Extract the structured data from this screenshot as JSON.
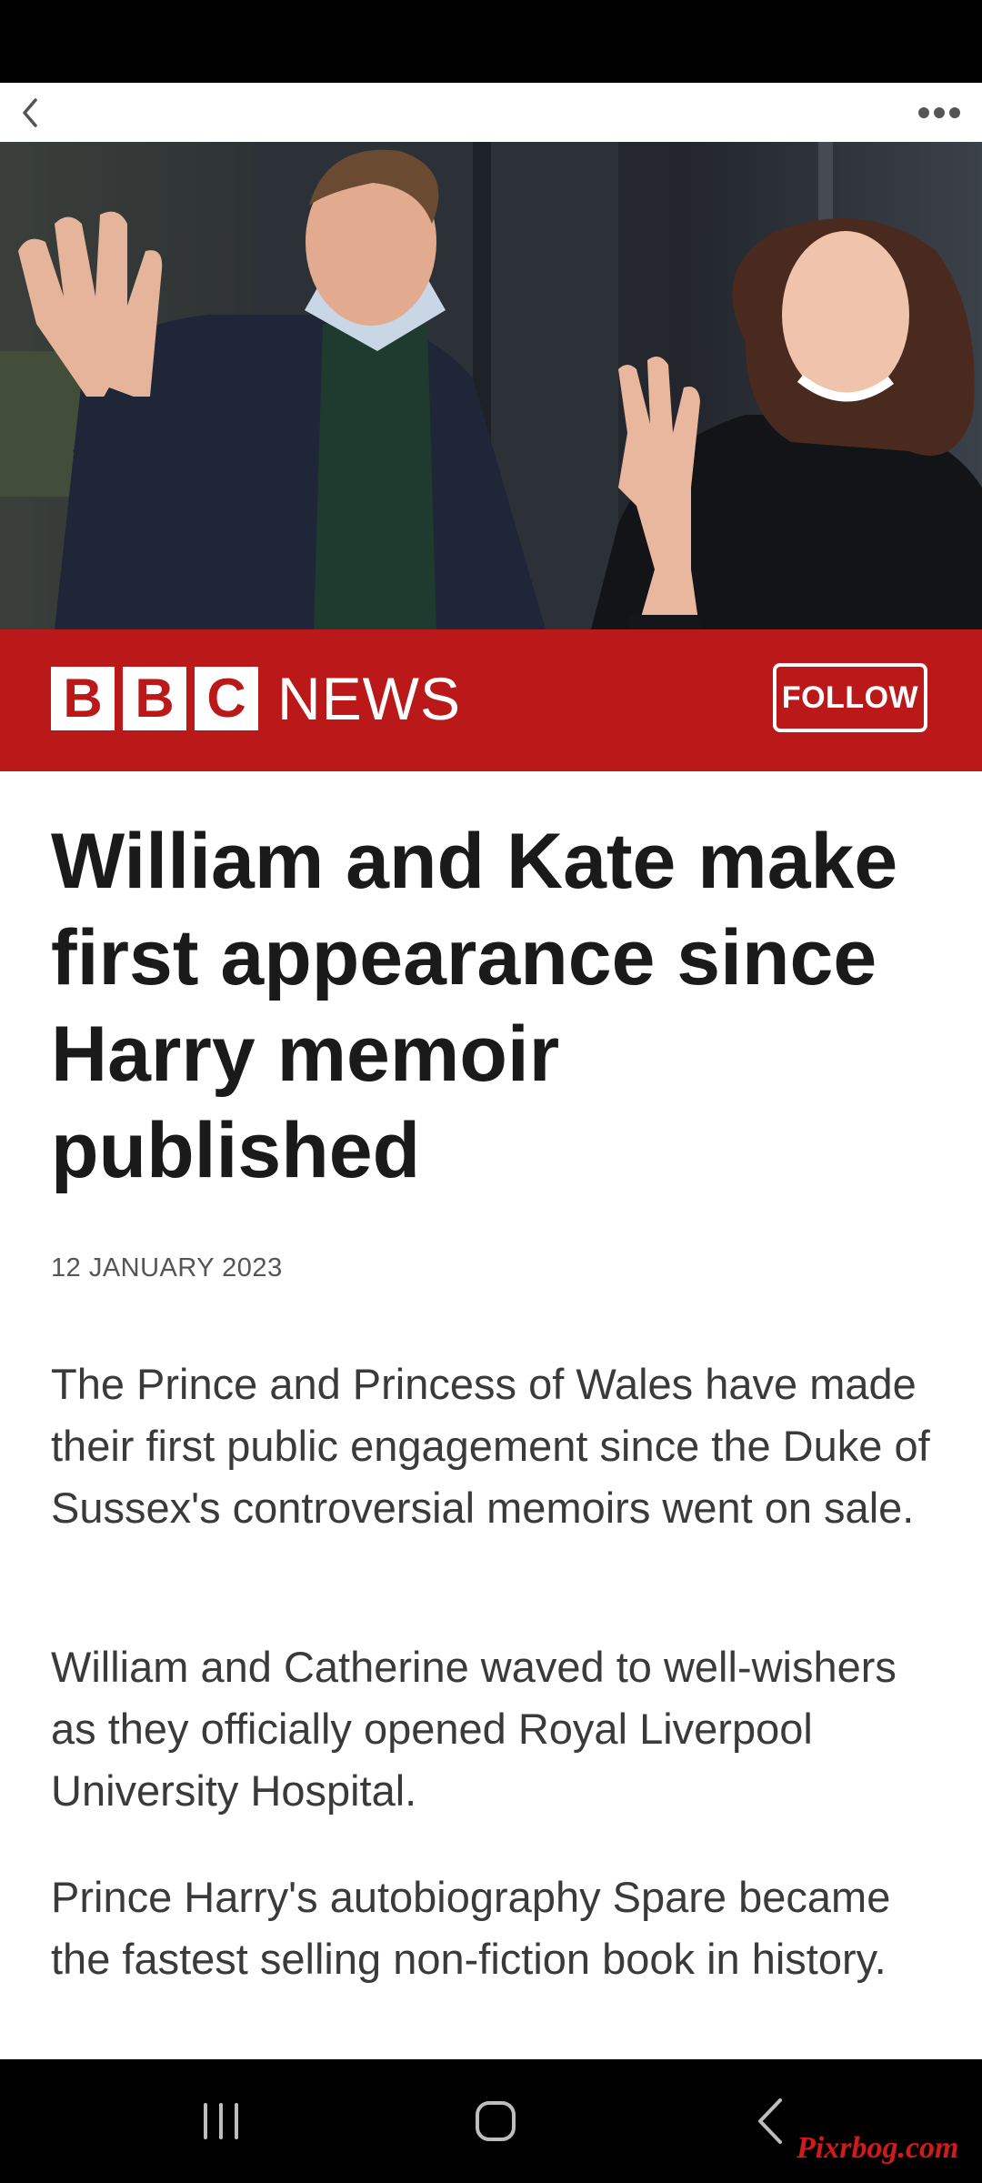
{
  "toolbar": {
    "back_icon": "chevron-left-icon",
    "more_icon": "more-horizontal-icon"
  },
  "hero_image": {
    "description_icon": "photo"
  },
  "brand": {
    "logo_letters": [
      "B",
      "B",
      "C"
    ],
    "logo_word": "NEWS",
    "follow_label": "FOLLOW",
    "color": "#bb1919"
  },
  "article": {
    "headline": "William and Kate make first appearance since Harry memoir published",
    "date": "12 JANUARY 2023",
    "paragraphs": [
      "The Prince and Princess of Wales have made their first public engagement since the Duke of Sussex's controversial memoirs went on sale.",
      "William and Catherine waved to well-wishers as they officially opened Royal Liverpool University Hospital.",
      "Prince Harry's autobiography Spare became the fastest selling non-fiction book in history."
    ]
  },
  "navigation": {
    "recents_icon": "recent-apps-icon",
    "home_icon": "home-icon",
    "back_icon": "back-icon"
  },
  "watermark": "Pixrbog.com"
}
